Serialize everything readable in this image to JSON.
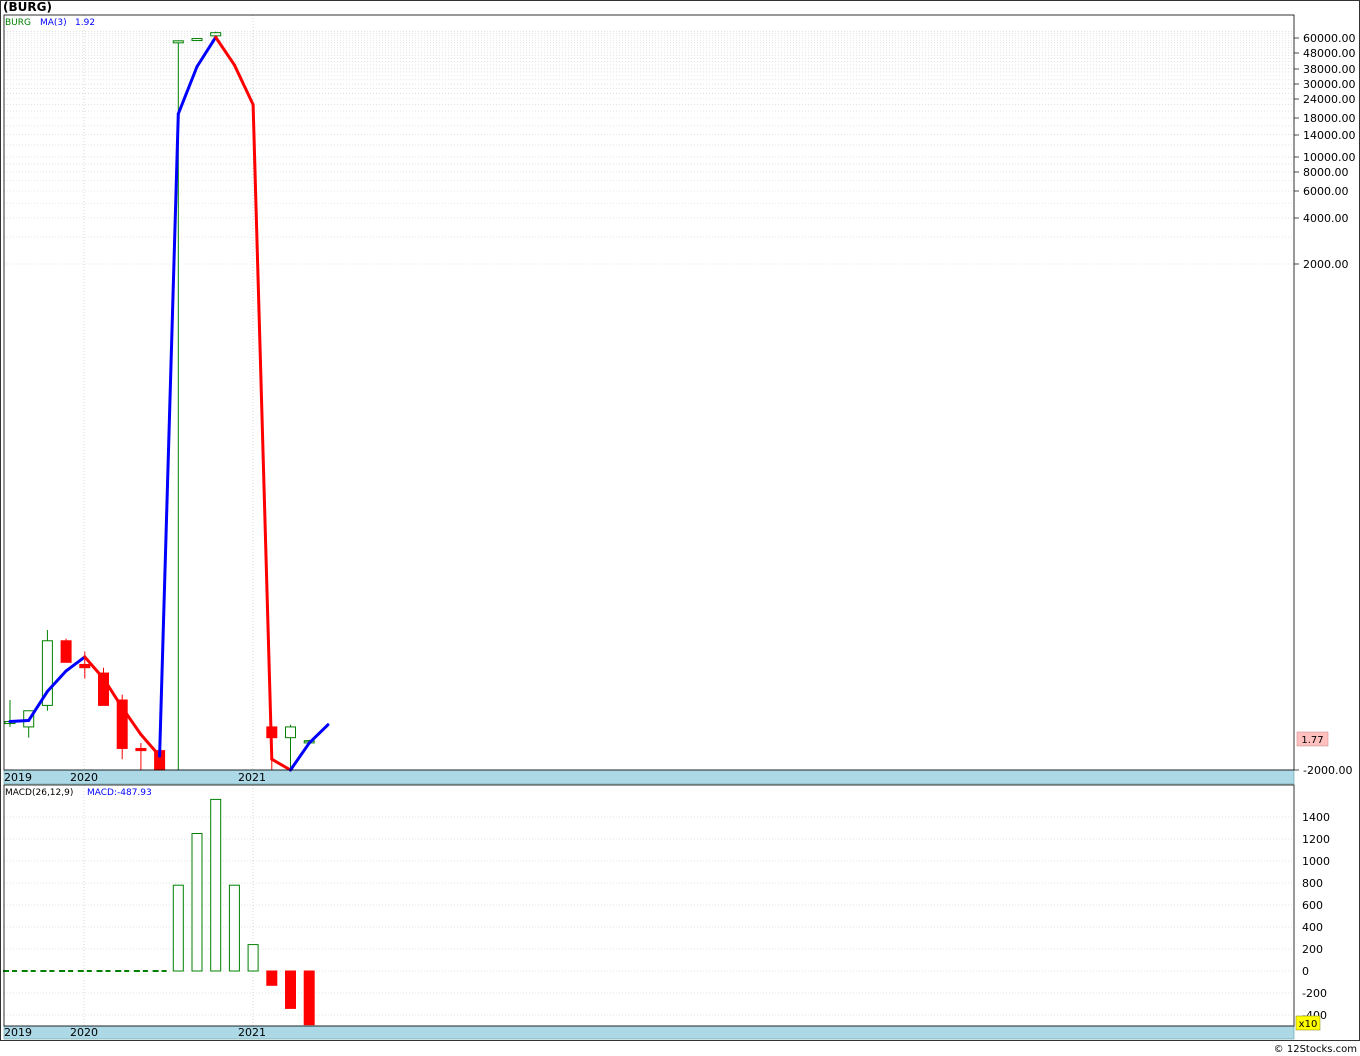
{
  "title": "(BURG)",
  "watermark": "© 12Stocks.com",
  "colors": {
    "up": "#008000",
    "down": "#ff0000",
    "ma_up": "#0000ff",
    "ma_down": "#ff0000",
    "axis_band": "#add8e6",
    "price_tag_bg": "#ffc0c0",
    "x10_bg": "#ffff00"
  },
  "price_panel": {
    "symbol": "BURG",
    "ma_label": "MA(3)",
    "ma_value": "1.92",
    "last_price": "1.77",
    "y_ticks": [
      {
        "label": "60000.00",
        "v": 60000
      },
      {
        "label": "48000.00",
        "v": 48000
      },
      {
        "label": "38000.00",
        "v": 38000
      },
      {
        "label": "30000.00",
        "v": 30000
      },
      {
        "label": "24000.00",
        "v": 24000
      },
      {
        "label": "18000.00",
        "v": 18000
      },
      {
        "label": "14000.00",
        "v": 14000
      },
      {
        "label": "10000.00",
        "v": 10000
      },
      {
        "label": "8000.00",
        "v": 8000
      },
      {
        "label": "6000.00",
        "v": 6000
      },
      {
        "label": "4000.00",
        "v": 4000
      },
      {
        "label": "2000.00",
        "v": 2000
      },
      {
        "label": "-2000.00",
        "v": -2000
      }
    ],
    "x_labels": [
      "2019",
      "2020",
      "2021"
    ]
  },
  "macd_panel": {
    "label": "MACD(26,12,9)",
    "value_label": "MACD:-487.93",
    "multiplier": "x10",
    "y_ticks": [
      "1400",
      "1200",
      "1000",
      "800",
      "600",
      "400",
      "200",
      "0",
      "-200",
      "-400"
    ],
    "x_labels": [
      "2019",
      "2020",
      "2021"
    ]
  },
  "chart_data": [
    {
      "type": "candlestick",
      "title": "(BURG)",
      "scale": "log",
      "months": [
        "2019-11",
        "2019-12",
        "2020-01",
        "2020-02",
        "2020-03",
        "2020-04",
        "2020-05",
        "2020-06",
        "2020-07",
        "2020-08",
        "2020-09",
        "2020-10",
        "2020-11",
        "2020-12",
        "2021-01",
        "2021-02",
        "2021-03",
        "2021-04"
      ],
      "ohlc": [
        {
          "o": 1.95,
          "h": 2.15,
          "l": 1.9,
          "c": 1.95
        },
        {
          "o": 1.9,
          "h": 2.05,
          "l": 1.8,
          "c": 2.05
        },
        {
          "o": 2.1,
          "h": 2.8,
          "l": 2.05,
          "c": 2.7
        },
        {
          "o": 2.7,
          "h": 2.72,
          "l": 2.5,
          "c": 2.5
        },
        {
          "o": 2.48,
          "h": 2.6,
          "l": 2.35,
          "c": 2.45
        },
        {
          "o": 2.4,
          "h": 2.45,
          "l": 2.1,
          "c": 2.1
        },
        {
          "o": 2.15,
          "h": 2.2,
          "l": 1.6,
          "c": 1.7
        },
        {
          "o": 1.7,
          "h": 1.75,
          "l": 1.5,
          "c": 1.68
        },
        {
          "o": 1.68,
          "h": 1.68,
          "l": 1.5,
          "c": 1.5
        },
        {
          "o": 57000,
          "h": 58000,
          "l": 1.5,
          "c": 57500
        },
        {
          "o": 59000,
          "h": 60000,
          "l": 58500,
          "c": 59500
        },
        {
          "o": 62000,
          "h": 66000,
          "l": 62000,
          "c": 65000
        },
        {
          "o": null,
          "h": null,
          "l": null,
          "c": null
        },
        {
          "o": null,
          "h": null,
          "l": null,
          "c": null
        },
        {
          "o": 1.9,
          "h": 1.9,
          "l": 1.5,
          "c": 1.8
        },
        {
          "o": 1.8,
          "h": 1.92,
          "l": 1.5,
          "c": 1.9
        },
        {
          "o": 1.77,
          "h": 1.78,
          "l": 1.76,
          "c": 1.77
        },
        {
          "o": null,
          "h": null,
          "l": null,
          "c": null
        }
      ],
      "ma3": [
        1.95,
        1.96,
        2.23,
        2.42,
        2.55,
        2.35,
        2.08,
        1.83,
        1.63,
        19168,
        39000,
        60700,
        40000,
        22000,
        1.6,
        1.5,
        1.75,
        1.92
      ],
      "last_price": 1.77
    },
    {
      "type": "bar",
      "title": "MACD(26,12,9)",
      "months": [
        "2019-11",
        "2019-12",
        "2020-01",
        "2020-02",
        "2020-03",
        "2020-04",
        "2020-05",
        "2020-06",
        "2020-07",
        "2020-08",
        "2020-09",
        "2020-10",
        "2020-11",
        "2020-12",
        "2021-01",
        "2021-02",
        "2021-03"
      ],
      "values": [
        0,
        0,
        0,
        0,
        0,
        0,
        0,
        0,
        0,
        780,
        1250,
        1560,
        780,
        240,
        -130,
        -340,
        -487.93
      ],
      "ylim": [
        -400,
        1500
      ]
    }
  ]
}
